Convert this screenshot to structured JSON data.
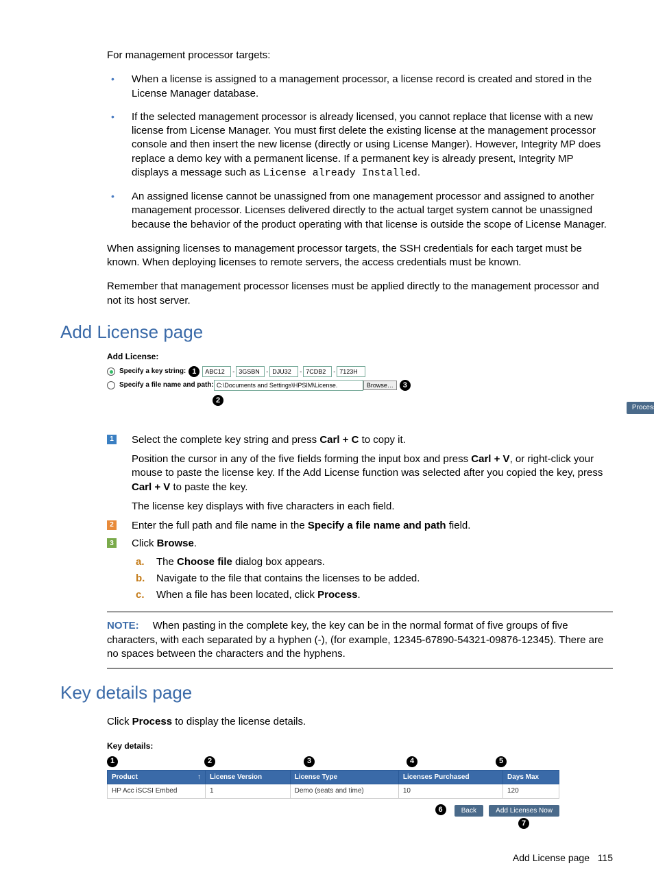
{
  "intro": "For management processor targets:",
  "bullets": [
    "When a license is assigned to a management processor, a license record is created and stored in the License Manager database.",
    {
      "pre": "If the selected management processor is already licensed, you cannot replace that license with a new license from License Manager. You must first delete the existing license at the management processor console and then insert the new license (directly or using License Manger). However, Integrity MP does replace a demo key with a permanent license. If a permanent key is already present, Integrity MP displays a message such as ",
      "code": "License already Installed",
      "post": "."
    },
    "An assigned license cannot be unassigned from one management processor and assigned to another management processor. Licenses delivered directly to the actual target system cannot be unassigned because the behavior of the product operating with that license is outside the scope of License Manager."
  ],
  "para1": "When assigning licenses to management processor targets, the SSH credentials for each target must be known. When deploying licenses to remote servers, the access credentials must be known.",
  "para2": "Remember that management processor licenses must be applied directly to the management processor and not its host server.",
  "h_add": "Add License page",
  "fig1": {
    "title": "Add License:",
    "opt1": "Specify a key string:",
    "opt2": "Specify a file name and path:",
    "keys": [
      "ABC12",
      "3GSBN",
      "DJU32",
      "7CDB2",
      "7123H"
    ],
    "path": "C:\\Documents and Settings\\HPSIM\\License.",
    "browse": "Browse…",
    "process": "Process…"
  },
  "steps": {
    "s1a_pre": "Select the complete key string and press ",
    "s1a_b": "Carl + C",
    "s1a_post": " to copy it.",
    "s1b_pre": "Position the cursor in any of the five fields forming the input box and press ",
    "s1b_b1": "Carl + V",
    "s1b_mid": ", or right-click your mouse to paste the license key. If the Add License function was selected after you copied the key, press ",
    "s1b_b2": "Carl + V",
    "s1b_post": " to paste the key.",
    "s1c": "The license key displays with five characters in each field.",
    "s2_pre": "Enter the full path and file name in the ",
    "s2_b": "Specify a file name and path",
    "s2_post": " field.",
    "s3_pre": "Click ",
    "s3_b": "Browse",
    "s3_post": ".",
    "sub_a_pre": "The ",
    "sub_a_b": "Choose file",
    "sub_a_post": " dialog box appears.",
    "sub_b": "Navigate to the file that contains the licenses to be added.",
    "sub_c_pre": "When a file has been located, click ",
    "sub_c_b": "Process",
    "sub_c_post": "."
  },
  "note": {
    "label": "NOTE:",
    "text": "When pasting in the complete key, the key can be in the normal format of five groups of five characters, with each separated by a hyphen (-), (for example, 12345-67890-54321-09876-12345). There are no spaces between the characters and the hyphens."
  },
  "h_key": "Key details page",
  "kd_intro_pre": "Click  ",
  "kd_intro_b": "Process",
  "kd_intro_post": " to display the license details.",
  "kd": {
    "title": "Key details:",
    "headers": [
      "Product",
      "License Version",
      "License Type",
      "Licenses Purchased",
      "Days Max"
    ],
    "row": [
      "HP Acc iSCSI Embed",
      "1",
      "Demo (seats and time)",
      "10",
      "120"
    ],
    "back": "Back",
    "add": "Add Licenses Now"
  },
  "footer": {
    "label": "Add License page",
    "num": "115"
  }
}
